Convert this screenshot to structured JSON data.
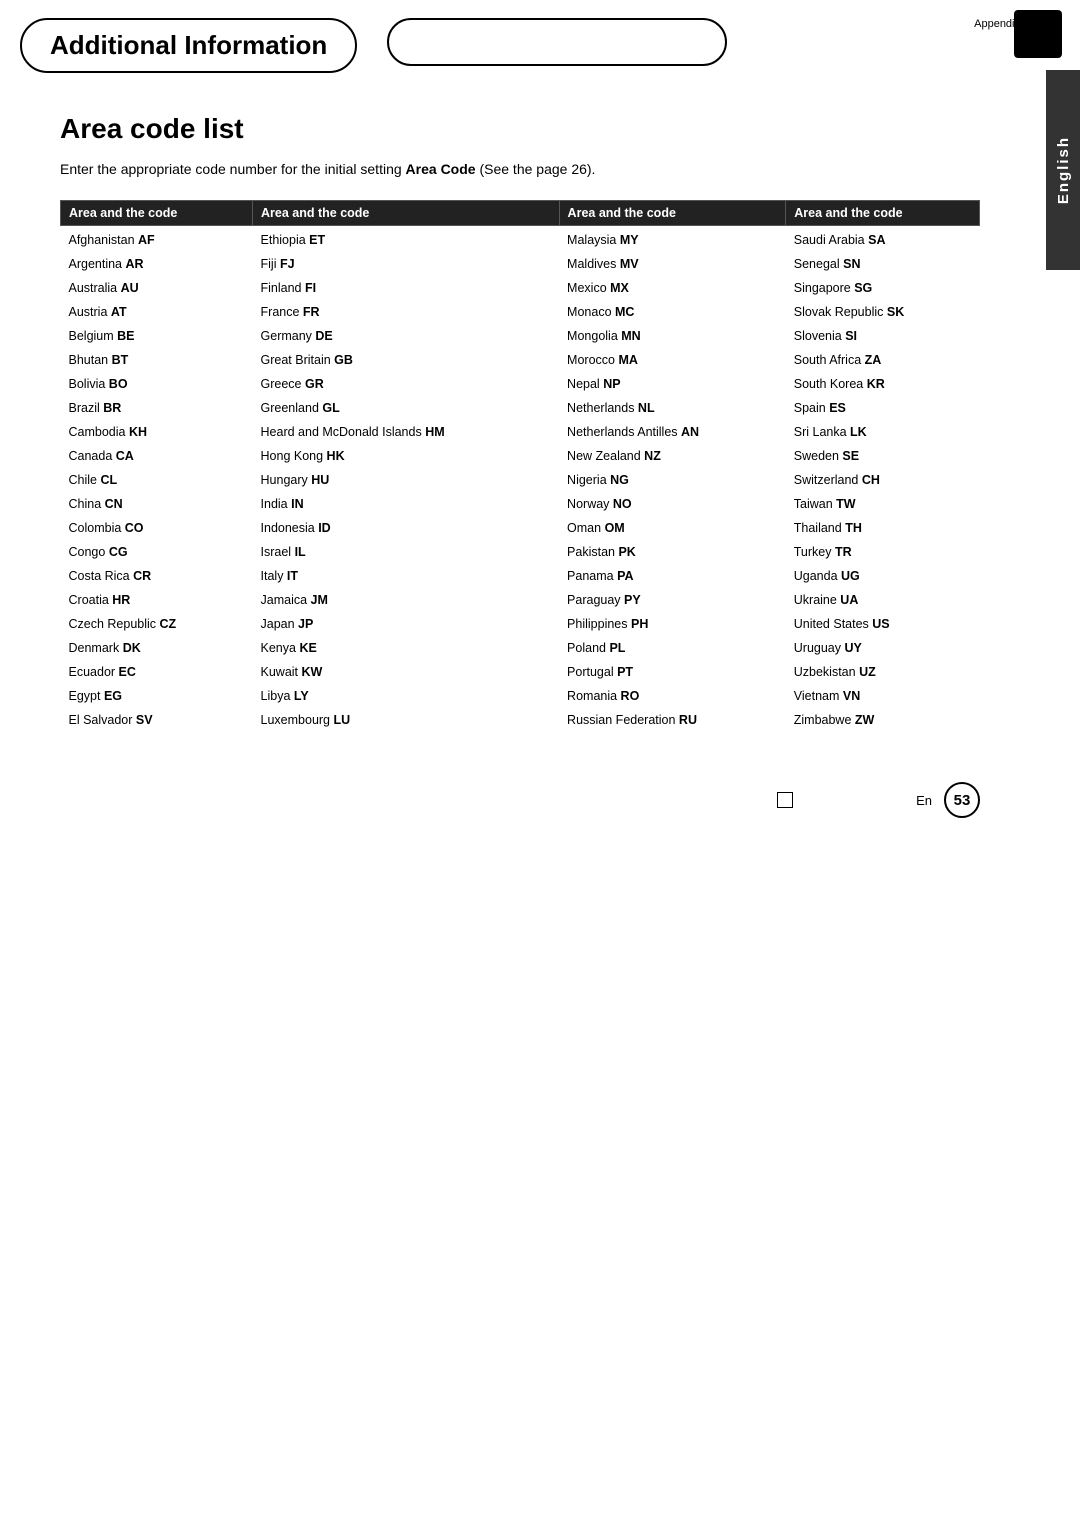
{
  "header": {
    "appendix": "Appendix",
    "title": "Additional Information",
    "english_label": "English",
    "page_num": "53",
    "en_label": "En"
  },
  "section": {
    "title": "Area code list",
    "intro": "Enter the appropriate code number for the initial setting ",
    "intro_bold": "Area Code",
    "intro_end": " (See the page 26)."
  },
  "table": {
    "col_header": "Area and the code",
    "columns": [
      [
        "Afghanistan AF",
        "Argentina AR",
        "Australia AU",
        "Austria AT",
        "Belgium BE",
        "Bhutan BT",
        "Bolivia BO",
        "Brazil BR",
        "Cambodia KH",
        "Canada CA",
        "Chile CL",
        "China CN",
        "Colombia CO",
        "Congo CG",
        "Costa Rica CR",
        "Croatia HR",
        "Czech Republic CZ",
        "Denmark DK",
        "Ecuador EC",
        "Egypt EG",
        "El Salvador SV"
      ],
      [
        "Ethiopia ET",
        "Fiji FJ",
        "Finland FI",
        "France FR",
        "Germany DE",
        "Great Britain GB",
        "Greece GR",
        "Greenland GL",
        "Heard and McDonald Islands HM",
        "Hong Kong HK",
        "Hungary HU",
        "India IN",
        "Indonesia ID",
        "Israel IL",
        "Italy IT",
        "Jamaica JM",
        "Japan JP",
        "Kenya KE",
        "Kuwait KW",
        "Libya LY",
        "Luxembourg LU"
      ],
      [
        "Malaysia MY",
        "Maldives MV",
        "Mexico MX",
        "Monaco MC",
        "Mongolia MN",
        "Morocco MA",
        "Nepal NP",
        "Netherlands NL",
        "Netherlands Antilles AN",
        "New Zealand NZ",
        "Nigeria NG",
        "Norway NO",
        "Oman OM",
        "Pakistan PK",
        "Panama PA",
        "Paraguay PY",
        "Philippines PH",
        "Poland PL",
        "Portugal PT",
        "Romania RO",
        "Russian Federation RU"
      ],
      [
        "Saudi Arabia SA",
        "Senegal SN",
        "Singapore SG",
        "Slovak Republic SK",
        "Slovenia SI",
        "South Africa ZA",
        "South Korea KR",
        "Spain ES",
        "Sri Lanka LK",
        "Sweden SE",
        "Switzerland CH",
        "Taiwan TW",
        "Thailand TH",
        "Turkey TR",
        "Uganda UG",
        "Ukraine UA",
        "United States US",
        "Uruguay UY",
        "Uzbekistan UZ",
        "Vietnam VN",
        "Zimbabwe ZW"
      ]
    ],
    "bold_codes": {
      "Afghanistan": "AF",
      "Argentina": "AR",
      "Australia": "AU",
      "Austria": "AT",
      "Belgium": "BE",
      "Bhutan": "BT",
      "Bolivia": "BO",
      "Brazil": "BR",
      "Cambodia": "KH",
      "Canada": "CA",
      "Chile": "CL",
      "China": "CN",
      "Colombia": "CO",
      "Congo": "CG",
      "Costa Rica": "CR",
      "Croatia": "HR",
      "Czech Republic": "CZ",
      "Denmark": "DK",
      "Ecuador": "EC",
      "Egypt": "EG",
      "El Salvador": "SV",
      "Ethiopia": "ET",
      "Fiji": "FJ",
      "Finland": "FI",
      "France": "FR",
      "Germany": "DE",
      "Great Britain": "GB",
      "Greece": "GR",
      "Greenland": "GL",
      "Heard and McDonald Islands": "HM",
      "Hong Kong": "HK",
      "Hungary": "HU",
      "India": "IN",
      "Indonesia": "ID",
      "Israel": "IL",
      "Italy": "IT",
      "Jamaica": "JM",
      "Japan": "JP",
      "Kenya": "KE",
      "Kuwait": "KW",
      "Libya": "LY",
      "Luxembourg": "LU"
    }
  }
}
